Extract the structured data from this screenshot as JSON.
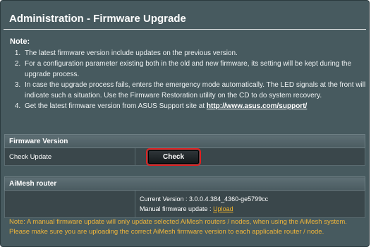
{
  "title": "Administration - Firmware Upgrade",
  "note_heading": "Note:",
  "notes": [
    "The latest firmware version include updates on the previous version.",
    "For a configuration parameter existing both in the old and new firmware, its setting will be kept during the upgrade process.",
    "In case the upgrade process fails, enters the emergency mode automatically. The LED signals at the front will indicate such a situation. Use the Firmware Restoration utility on the CD to do system recovery.",
    "Get the latest firmware version from ASUS Support site at "
  ],
  "support_link": "http://www.asus.com/support/",
  "firmware_section": {
    "heading": "Firmware Version",
    "check_update_label": "Check Update",
    "check_button": "Check"
  },
  "aimesh_section": {
    "heading": "AiMesh router",
    "current_version": "Current Version : 3.0.0.4.384_4360-ge5799cc",
    "manual_update_label": "Manual firmware update : ",
    "upload_link": "Upload"
  },
  "warning": "Note: A manual firmware update will only update selected AiMesh routers / nodes, when using the AiMesh system. Please make sure you are uploading the correct AiMesh firmware version to each applicable router / node.",
  "colors": {
    "panel_bg": "#475a5f",
    "warning_text": "#f0b63a",
    "button_highlight": "#e02020"
  }
}
